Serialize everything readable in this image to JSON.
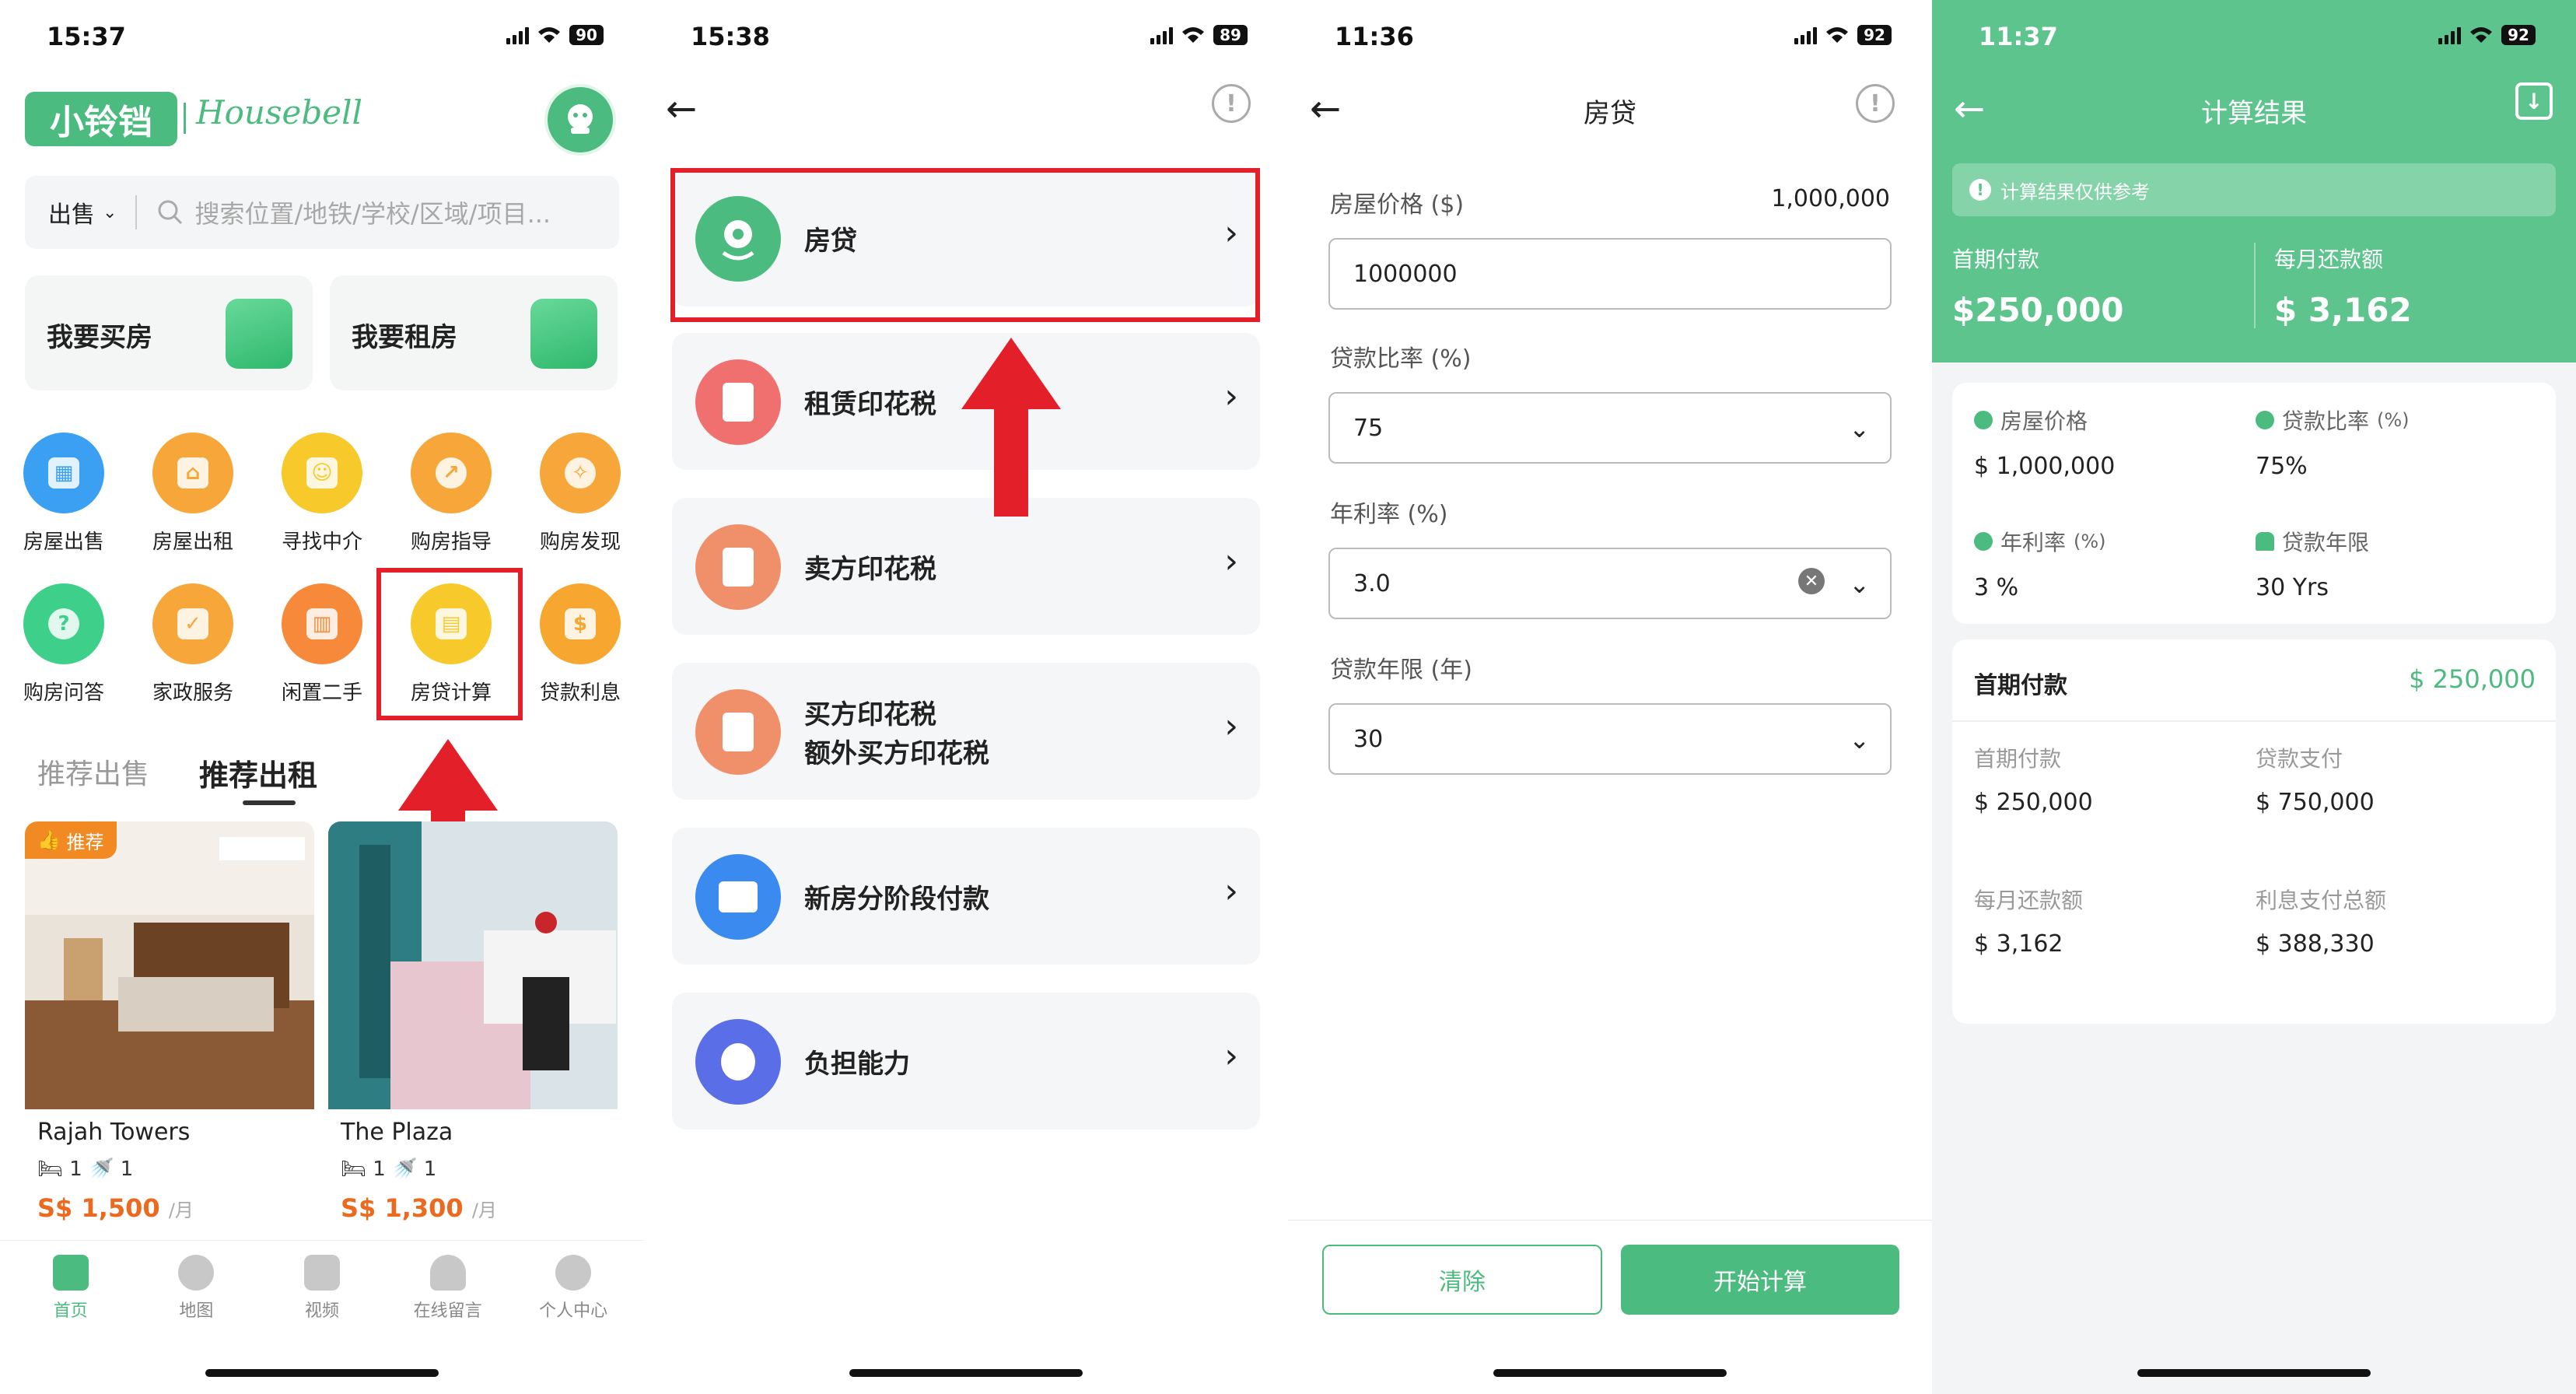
{
  "status": {
    "p1": {
      "time": "15:37",
      "battery": "90"
    },
    "p2": {
      "time": "15:38",
      "battery": "89"
    },
    "p3": {
      "time": "11:36",
      "battery": "92"
    },
    "p4": {
      "time": "11:37",
      "battery": "92"
    }
  },
  "home": {
    "logo_cn": "小铃铛",
    "logo_en": "Housebell",
    "search_mode": "出售",
    "search_placeholder": "搜索位置/地铁/学校/区域/项目...",
    "buy_label": "我要买房",
    "rent_label": "我要租房",
    "grid": [
      {
        "label": "房屋出售",
        "color": "#3b9ff2"
      },
      {
        "label": "房屋出租",
        "color": "#f7a63a"
      },
      {
        "label": "寻找中介",
        "color": "#f7c92a"
      },
      {
        "label": "购房指导",
        "color": "#f7a63a"
      },
      {
        "label": "购房发现",
        "color": "#f7a63a"
      },
      {
        "label": "购房问答",
        "color": "#3ed08a"
      },
      {
        "label": "家政服务",
        "color": "#f7a63a"
      },
      {
        "label": "闲置二手",
        "color": "#f78a3a"
      },
      {
        "label": "房贷计算",
        "color": "#f7c92a"
      },
      {
        "label": "贷款利息",
        "color": "#f7a630"
      }
    ],
    "tab_sale": "推荐出售",
    "tab_rent": "推荐出租",
    "listings": [
      {
        "badge": "推荐",
        "name": "Rajah Towers",
        "bed": "1",
        "bath": "1",
        "price": "S$ 1,500",
        "unit": "/月"
      },
      {
        "name": "The Plaza",
        "bed": "1",
        "bath": "1",
        "price": "S$ 1,300",
        "unit": "/月"
      }
    ],
    "tabbar": [
      "首页",
      "地图",
      "视频",
      "在线留言",
      "个人中心"
    ]
  },
  "menu": {
    "items": [
      {
        "label": "房贷",
        "color": "#4cbb7f"
      },
      {
        "label": "租赁印花税",
        "color": "#f07070"
      },
      {
        "label": "卖方印花税",
        "color": "#f0906a"
      },
      {
        "label": "买方印花税",
        "label2": "额外买方印花税",
        "color": "#f0906a"
      },
      {
        "label": "新房分阶段付款",
        "color": "#3b8af0"
      },
      {
        "label": "负担能力",
        "color": "#5a6ee8"
      }
    ]
  },
  "form": {
    "title": "房贷",
    "price_label": "房屋价格 ($)",
    "price_display": "1,000,000",
    "price_input": "1000000",
    "ratio_label": "贷款比率 (%)",
    "ratio_value": "75",
    "rate_label": "年利率 (%)",
    "rate_value": "3.0",
    "term_label": "贷款年限 (年)",
    "term_value": "30",
    "clear_btn": "清除",
    "calc_btn": "开始计算"
  },
  "result": {
    "title": "计算结果",
    "notice": "计算结果仅供参考",
    "down_label": "首期付款",
    "down_value": "$250,000",
    "monthly_label": "每月还款额",
    "monthly_value": "$ 3,162",
    "price_label": "房屋价格",
    "price_value": "$ 1,000,000",
    "ratio_label": "贷款比率",
    "ratio_unit": "(%)",
    "ratio_value": "75%",
    "rate_label": "年利率",
    "rate_unit": "(%)",
    "rate_value": "3 %",
    "term_label": "贷款年限",
    "term_value": "30 Yrs",
    "sec_title": "首期付款",
    "sec_total": "$ 250,000",
    "d_down_label": "首期付款",
    "d_down_value": "$ 250,000",
    "d_loan_label": "贷款支付",
    "d_loan_value": "$ 750,000",
    "d_month_label": "每月还款额",
    "d_month_value": "$ 3,162",
    "d_int_label": "利息支付总额",
    "d_int_value": "$ 388,330"
  }
}
